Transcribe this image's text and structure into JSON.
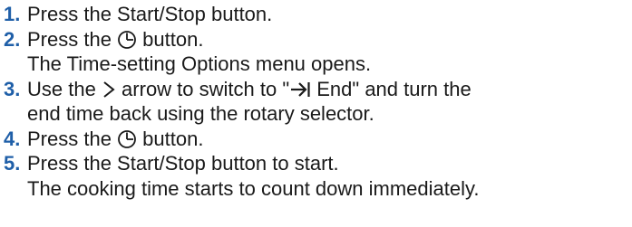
{
  "steps": [
    {
      "number": "1.",
      "lines": [
        {
          "before": "Press the Start/Stop button."
        }
      ]
    },
    {
      "number": "2.",
      "lines": [
        {
          "before": "Press the ",
          "icon": "clock-icon",
          "after": " button."
        },
        {
          "before": "The Time-setting Options menu opens."
        }
      ]
    },
    {
      "number": "3.",
      "lines": [
        {
          "before": "Use the ",
          "icon": "chevron-right-icon",
          "after": " arrow to switch to \"",
          "icon2": "arrow-to-end-icon",
          "after2": " End\" and turn the"
        },
        {
          "before": "end time back using the rotary selector."
        }
      ]
    },
    {
      "number": "4.",
      "lines": [
        {
          "before": "Press the ",
          "icon": "clock-icon",
          "after": " button."
        }
      ]
    },
    {
      "number": "5.",
      "lines": [
        {
          "before": "Press the Start/Stop button to start."
        },
        {
          "before": "The cooking time starts to count down immediately."
        }
      ]
    }
  ],
  "colors": {
    "number": "#1f5fa8",
    "text": "#1a1a1a"
  }
}
